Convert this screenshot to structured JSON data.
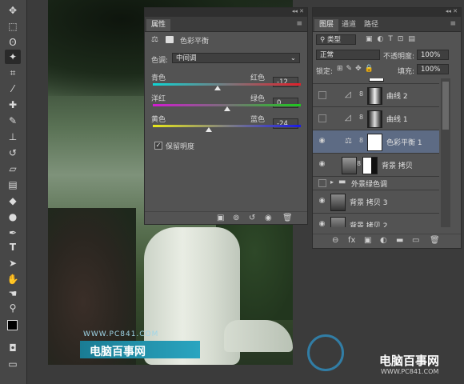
{
  "properties_panel": {
    "title": "属性",
    "adjustment_name": "色彩平衡",
    "tone_label": "色调:",
    "tone_value": "中间调",
    "sliders": [
      {
        "left": "青色",
        "right": "红色",
        "value": "-12",
        "level": 0.44
      },
      {
        "left": "洋红",
        "right": "绿色",
        "value": "0",
        "level": 0.5
      },
      {
        "left": "黄色",
        "right": "蓝色",
        "value": "-24",
        "level": 0.38
      }
    ],
    "preserve_luminosity": "保留明度"
  },
  "layers_panel": {
    "tabs": [
      "图层",
      "通道",
      "路径"
    ],
    "filter_kind": "类型",
    "blend_mode": "正常",
    "opacity_label": "不透明度:",
    "opacity_value": "100%",
    "lock_label": "锁定:",
    "fill_label": "填充:",
    "fill_value": "100%",
    "layers": [
      {
        "name": "曲线 2",
        "visible": false,
        "kind": "adjustment"
      },
      {
        "name": "曲线 1",
        "visible": false,
        "kind": "adjustment"
      },
      {
        "name": "色彩平衡 1",
        "visible": true,
        "kind": "adjustment",
        "selected": true
      },
      {
        "name": "背景 拷贝",
        "visible": true,
        "kind": "masked"
      },
      {
        "name": "外景绿色调",
        "visible": false,
        "kind": "group"
      },
      {
        "name": "背景 拷贝 3",
        "visible": true,
        "kind": "image"
      },
      {
        "name": "背景 拷贝 2",
        "visible": true,
        "kind": "image"
      }
    ]
  },
  "watermark": {
    "url": "WWW.PC841.COM",
    "title": "电脑百事网",
    "brand": "电脑百事网",
    "brand_url": "WWW.PC841.COM"
  },
  "colors": {
    "panel": "#535353",
    "selected_layer": "#5d6b84",
    "accent_cyan_red": [
      "#0fd4d4",
      "#e0202a"
    ],
    "accent_magenta_green": [
      "#d21ad2",
      "#1ec81e"
    ],
    "accent_yellow_blue": [
      "#e8e81a",
      "#1a1ae8"
    ]
  }
}
